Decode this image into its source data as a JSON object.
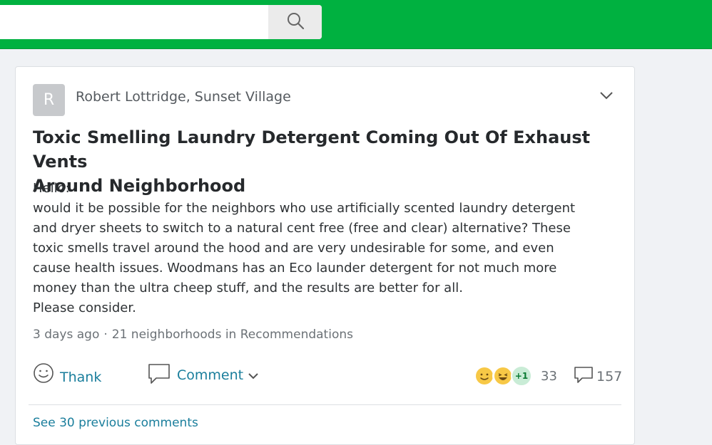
{
  "search": {
    "value": "",
    "placeholder": ""
  },
  "post": {
    "avatar_letter": "R",
    "author": "Robert Lottridge, Sunset Village",
    "title_lines": [
      "Toxic Smelling Laundry Detergent Coming Out Of Exhaust Vents",
      "Around Neighborhood"
    ],
    "body_lines": [
      "Hello:",
      "would it be possible for the neighbors who use artificially scented laundry detergent",
      "and dryer sheets to switch to a natural cent free (free and clear) alternative? These",
      "toxic smells travel around the hood and are very undesirable for some, and even",
      "cause health issues. Woodmans has an Eco launder detergent for not much more",
      "money than the ultra cheep stuff, and the results are better for all.",
      "Please consider."
    ],
    "time": "3 days ago",
    "separator": "·",
    "scope": "21 neighborhoods in Recommendations"
  },
  "actions": {
    "thank_label": "Thank",
    "comment_label": "Comment",
    "reaction_extra": "+1",
    "reaction_count": "33",
    "reply_count": "157"
  },
  "footer": {
    "see_more": "See 30 previous comments"
  },
  "icons": {
    "search": "search-icon",
    "menu": "chevron-down-icon",
    "thank": "smiley-icon",
    "comment": "speech-bubble-icon",
    "replies": "speech-bubble-icon"
  },
  "colors": {
    "brand": "#00b140",
    "link": "#1a7e9c"
  }
}
